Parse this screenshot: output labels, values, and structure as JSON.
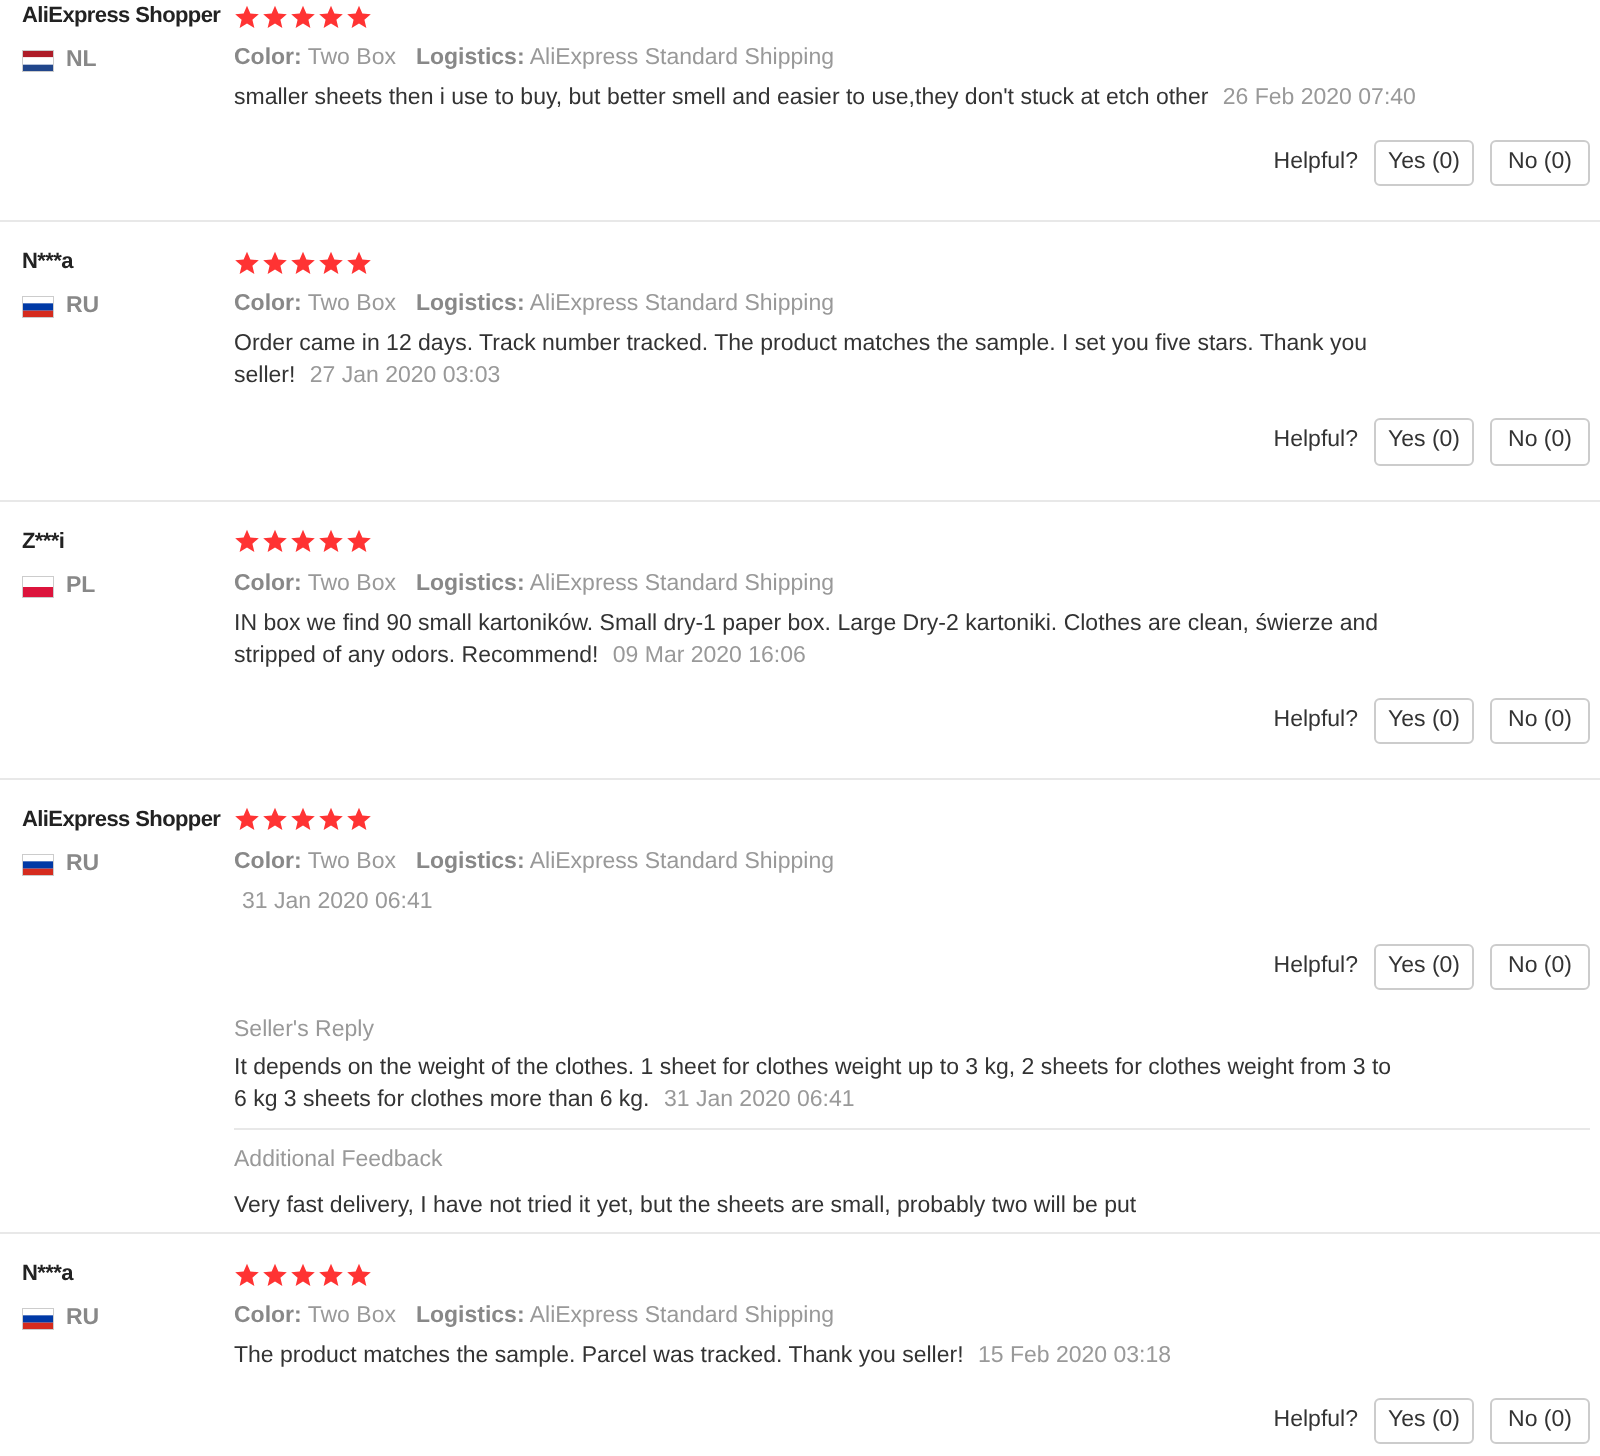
{
  "reviews": [
    {
      "name": "AliExpress Shopper",
      "country": "NL",
      "flag": {
        "kind": "netherlands"
      },
      "stars": 5,
      "color_label": "Color:",
      "color_value": "Two Box",
      "logistics_label": "Logistics:",
      "logistics_value": "AliExpress Standard Shipping",
      "text": "smaller sheets then i use to buy, but better smell and easier to use,they don't stuck at etch other",
      "date": "26 Feb 2020 07:40",
      "helpful_label": "Helpful?",
      "yes": "Yes (0)",
      "no": "No (0)"
    },
    {
      "name": "N***a",
      "country": "RU",
      "flag": {
        "kind": "russia"
      },
      "stars": 5,
      "color_label": "Color:",
      "color_value": "Two Box",
      "logistics_label": "Logistics:",
      "logistics_value": "AliExpress Standard Shipping",
      "text": "Order came in 12 days. Track number tracked. The product matches the sample. I set you five stars. Thank you seller!",
      "date": "27 Jan 2020 03:03",
      "helpful_label": "Helpful?",
      "yes": "Yes (0)",
      "no": "No (0)"
    },
    {
      "name": "Z***i",
      "country": "PL",
      "flag": {
        "kind": "poland"
      },
      "stars": 5,
      "color_label": "Color:",
      "color_value": "Two Box",
      "logistics_label": "Logistics:",
      "logistics_value": "AliExpress Standard Shipping",
      "text": "IN box we find 90 small kartoników. Small dry-1 paper box. Large Dry-2 kartoniki. Clothes are clean, świerze and stripped of any odors. Recommend!",
      "date": "09 Mar 2020 16:06",
      "helpful_label": "Helpful?",
      "yes": "Yes (0)",
      "no": "No (0)"
    },
    {
      "name": "AliExpress Shopper",
      "country": "RU",
      "flag": {
        "kind": "russia"
      },
      "stars": 5,
      "color_label": "Color:",
      "color_value": "Two Box",
      "logistics_label": "Logistics:",
      "logistics_value": "AliExpress Standard Shipping",
      "date": "31 Jan 2020 06:41",
      "helpful_label": "Helpful?",
      "yes": "Yes (0)",
      "no": "No (0)",
      "seller_reply": {
        "title": "Seller's Reply",
        "text": "It depends on the weight of the clothes. 1 sheet for clothes weight up to 3 kg, 2 sheets for clothes weight from 3 to 6 kg 3 sheets for clothes more than 6 kg.",
        "date": "31 Jan 2020 06:41"
      },
      "additional_feedback": {
        "title": "Additional Feedback",
        "text": "Very fast delivery, I have not tried it yet, but the sheets are small, probably two will be put"
      }
    },
    {
      "name": "N***a",
      "country": "RU",
      "flag": {
        "kind": "russia"
      },
      "stars": 5,
      "color_label": "Color:",
      "color_value": "Two Box",
      "logistics_label": "Logistics:",
      "logistics_value": "AliExpress Standard Shipping",
      "text": "The product matches the sample. Parcel was tracked. Thank you seller!",
      "date": "15 Feb 2020 03:18",
      "helpful_label": "Helpful?",
      "yes": "Yes (0)",
      "no": "No (0)"
    }
  ]
}
